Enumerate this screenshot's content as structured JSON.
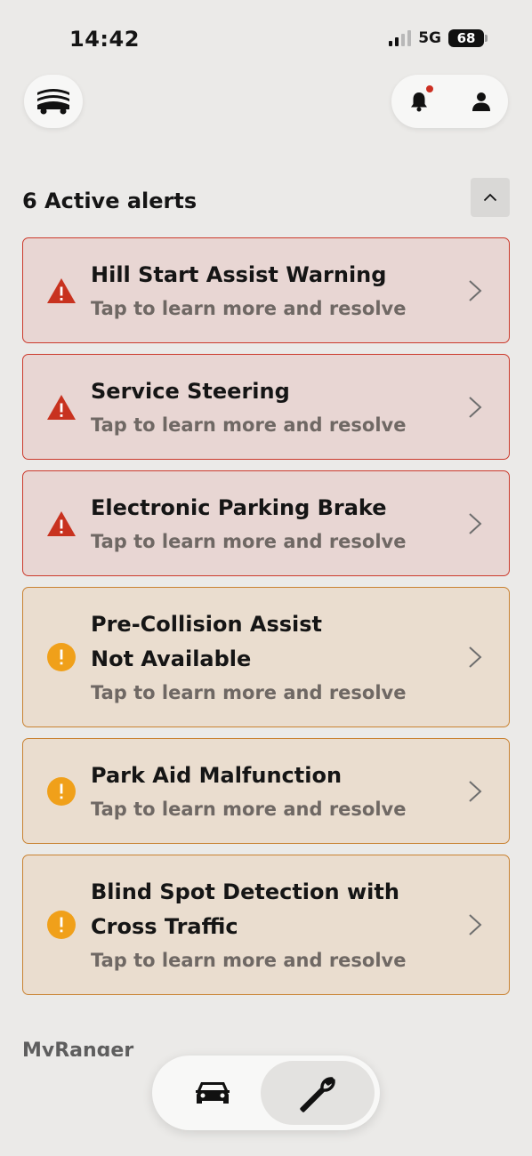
{
  "status_bar": {
    "time": "14:42",
    "network": "5G",
    "battery": "68"
  },
  "header": {
    "menu_icon": "vehicle-menu-icon",
    "notification_icon": "bell-icon",
    "profile_icon": "person-icon",
    "notification_dot_color": "#cc2f22"
  },
  "alerts_section": {
    "title": "6 Active alerts",
    "collapse_icon": "chevron-up-icon",
    "items": [
      {
        "title": "Hill Start Assist Warning",
        "subtitle": "Tap to learn more and resolve",
        "severity": "critical",
        "icon": "warning-triangle-icon"
      },
      {
        "title": "Service Steering",
        "subtitle": "Tap to learn more and resolve",
        "severity": "critical",
        "icon": "warning-triangle-icon"
      },
      {
        "title": "Electronic Parking Brake",
        "subtitle": "Tap to learn more and resolve",
        "severity": "critical",
        "icon": "warning-triangle-icon"
      },
      {
        "title": "Pre-Collision Assist Not Available",
        "subtitle": "Tap to learn more and resolve",
        "severity": "warning",
        "icon": "warning-circle-icon"
      },
      {
        "title": "Park Aid Malfunction",
        "subtitle": "Tap to learn more and resolve",
        "severity": "warning",
        "icon": "warning-circle-icon"
      },
      {
        "title": "Blind Spot Detection with Cross Traffic",
        "subtitle": "Tap to learn more and resolve",
        "severity": "warning",
        "icon": "warning-circle-icon"
      }
    ]
  },
  "footer_section": {
    "title": "MyRanger"
  },
  "bottom_nav": {
    "items": [
      {
        "icon": "car-icon",
        "active": false
      },
      {
        "icon": "wrench-icon",
        "active": true
      }
    ]
  },
  "colors": {
    "background": "#ebeae8",
    "critical_border": "#cc3a2c",
    "critical_bg": "#e8d6d3",
    "critical_icon": "#c8321f",
    "warning_border": "#c98232",
    "warning_bg": "#eaddcf",
    "warning_icon": "#f0a01a"
  }
}
